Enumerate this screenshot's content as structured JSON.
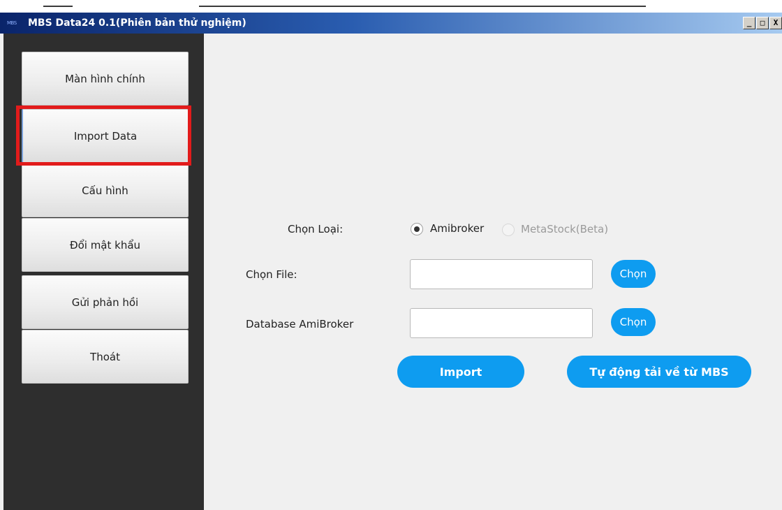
{
  "window": {
    "logo_text": "MBS",
    "title": "MBS Data24 0.1(Phiên bản thử nghiệm)",
    "controls": {
      "minimize": "_",
      "maximize": "□",
      "close": "X"
    }
  },
  "sidebar": {
    "items": [
      {
        "label": "Màn hình chính"
      },
      {
        "label": "Import Data",
        "selected": true
      },
      {
        "label": "Cấu hình"
      },
      {
        "label": "Đổi mật khẩu"
      },
      {
        "label": "Gửi phản hồi"
      },
      {
        "label": "Thoát"
      }
    ]
  },
  "form": {
    "type_label": "Chọn Loại:",
    "type_options": [
      {
        "label": "Amibroker",
        "checked": true,
        "enabled": true
      },
      {
        "label": "MetaStock(Beta)",
        "checked": false,
        "enabled": false
      }
    ],
    "file_label": "Chọn File:",
    "file_value": "",
    "file_button": "Chọn",
    "database_label": "Database AmiBroker",
    "database_value": "",
    "database_button": "Chọn",
    "import_button": "Import",
    "auto_download_button": "Tự động tải về từ MBS"
  },
  "colors": {
    "accent": "#0e9cf0",
    "sidebar_bg": "#2e2e2e",
    "highlight": "#e21b1b",
    "titlebar_start": "#0a246a",
    "titlebar_end": "#a6caf0"
  }
}
